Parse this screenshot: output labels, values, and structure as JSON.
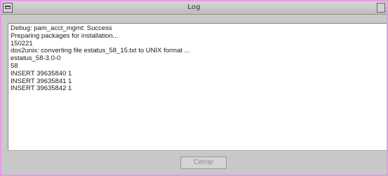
{
  "window": {
    "title": "Log"
  },
  "log": {
    "lines": [
      "Debug: pam_acct_mgmt: Success",
      "Preparing packages for installation...",
      "150221",
      "dos2unix: converting file estatus_58_15.txt to UNIX format ...",
      "estatus_58-3.0-0",
      "58",
      "INSERT 39635840 1",
      "INSERT 39635841 1",
      "INSERT 39635842 1"
    ]
  },
  "footer": {
    "close_label": "Cerrar",
    "close_enabled": false
  },
  "colors": {
    "window_border": "#e49be6",
    "chrome": "#c9c9c9",
    "log_background": "#ffffff",
    "disabled_text": "#8c8c8c"
  }
}
